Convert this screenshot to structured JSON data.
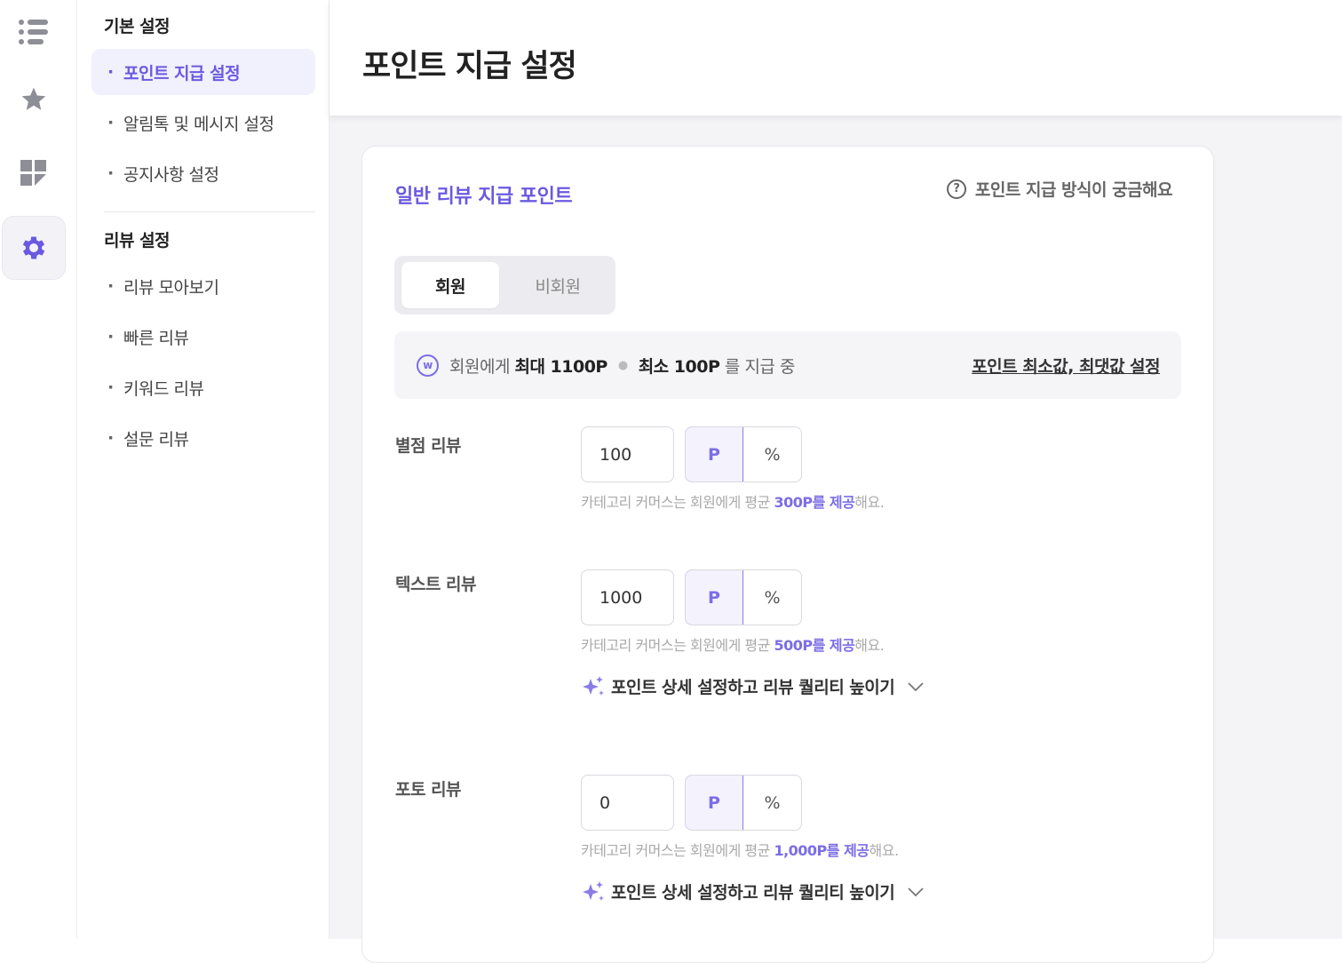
{
  "rail": {
    "items": [
      {
        "icon": "list-icon"
      },
      {
        "icon": "star-icon"
      },
      {
        "icon": "dashboard-icon"
      },
      {
        "icon": "gear-icon",
        "active": true
      }
    ]
  },
  "subnav": {
    "basic_title": "기본 설정",
    "basic_items": [
      {
        "label": "포인트 지급 설정",
        "active": true
      },
      {
        "label": "알림톡 및 메시지 설정"
      },
      {
        "label": "공지사항 설정"
      }
    ],
    "review_title": "리뷰 설정",
    "review_items": [
      {
        "label": "리뷰 모아보기"
      },
      {
        "label": "빠른 리뷰"
      },
      {
        "label": "키워드 리뷰"
      },
      {
        "label": "설문 리뷰"
      }
    ],
    "bullet": "·"
  },
  "header": {
    "title": "포인트 지급 설정"
  },
  "card": {
    "title": "일반 리뷰 지급 포인트",
    "help_icon": "?",
    "help_label": "포인트 지급 방식이 궁금해요",
    "tabs": [
      {
        "label": "회원"
      },
      {
        "label": "비회원"
      }
    ],
    "info": {
      "badge": "w",
      "prefix": "회원에게",
      "max": "최대 1100P",
      "sep": "●",
      "min": "최소 100P",
      "suffix": "를 지급 중",
      "link": "포인트 최소값, 최댓값 설정"
    },
    "rows": [
      {
        "label": "별점 리뷰",
        "value": "100",
        "unit_p": "P",
        "unit_pct": "%",
        "hint_pre": "카테고리 커머스는 회원에게 평균 ",
        "hint_hl": "300P를 제공",
        "hint_post": "해요."
      },
      {
        "label": "텍스트 리뷰",
        "value": "1000",
        "unit_p": "P",
        "unit_pct": "%",
        "hint_pre": "카테고리 커머스는 회원에게 평균 ",
        "hint_hl": "500P를 제공",
        "hint_post": "해요.",
        "expand": "포인트 상세 설정하고 리뷰 퀄리티 높이기"
      },
      {
        "label": "포토 리뷰",
        "value": "0",
        "unit_p": "P",
        "unit_pct": "%",
        "hint_pre": "카테고리 커머스는 회원에게 평균 ",
        "hint_hl": "1,000P를 제공",
        "hint_post": "해요.",
        "expand": "포인트 상세 설정하고 리뷰 퀄리티 높이기"
      }
    ]
  },
  "colors": {
    "accent": "#6a5ae0",
    "icon": "#8e8e96"
  }
}
